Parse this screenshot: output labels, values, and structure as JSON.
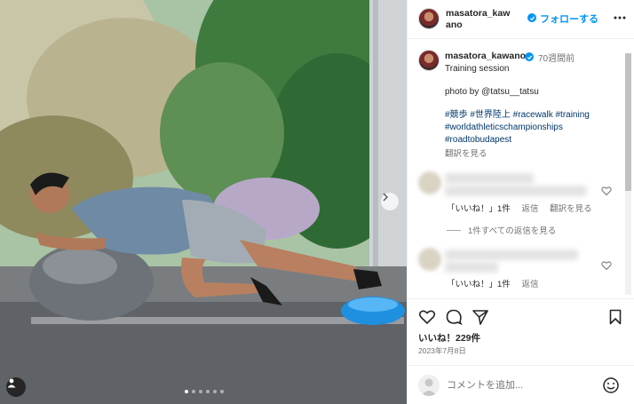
{
  "header": {
    "username": "masatora_kawano",
    "follow_label": "フォローする"
  },
  "caption": {
    "username": "masatora_kawano",
    "time_ago": "70週間前",
    "line1": "Training session",
    "photo_by": "photo by @tatsu__tatsu",
    "hashtags_line1": "#競歩 #世界陸上 #racewalk #training",
    "hashtags_line2": "#worldathleticschampionships",
    "hashtags_line3": "#roadtobudapest",
    "translate": "翻訳を見る"
  },
  "comments": [
    {
      "likes_label": "「いいね！」1件",
      "reply_label": "返信",
      "translate_label": "翻訳を見る"
    },
    {
      "likes_label": "「いいね！」1件",
      "reply_label": "返信"
    }
  ],
  "replies_toggle": "1件すべての返信を見る",
  "post": {
    "likes": "いいね！229件",
    "date": "2023年7月8日"
  },
  "comment_input": {
    "placeholder": "コメントを追加..."
  },
  "carousel": {
    "slide_count": 6,
    "active_index": 0
  },
  "colors": {
    "accent": "#0095f6",
    "hashtag": "#00376b"
  }
}
